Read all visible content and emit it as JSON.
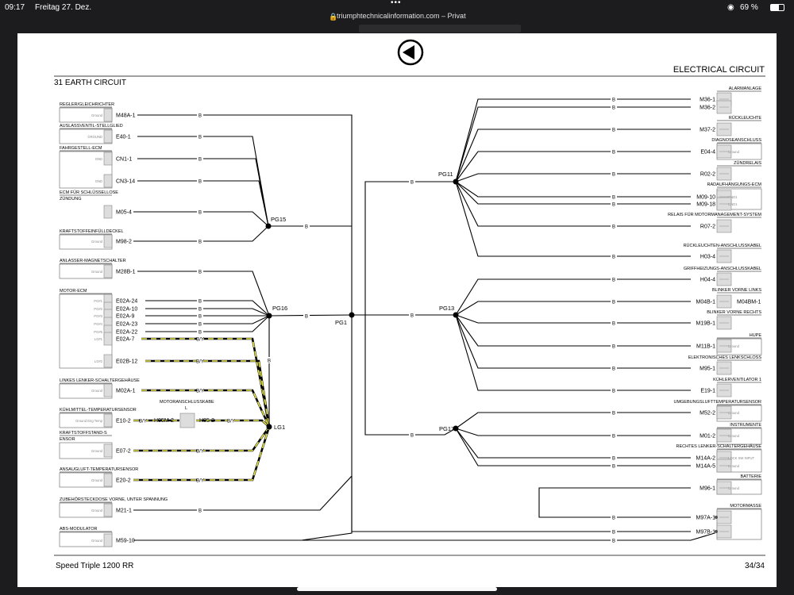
{
  "status": {
    "time": "09:17",
    "date": "Freitag 27. Dez.",
    "url": "triumphtechnicalinformation.com – Privat",
    "battery": "69 %",
    "dots": "•••"
  },
  "doc": {
    "header": "ELECTRICAL CIRCUIT",
    "section": "31 EARTH CIRCUIT",
    "footer_left": "Speed Triple 1200 RR",
    "footer_right": "34/34"
  },
  "wire": {
    "b": "B",
    "by": "B/Y"
  },
  "nodes": {
    "pg15": "PG15",
    "pg16": "PG16",
    "pg1": "PG1",
    "lg1": "LG1",
    "pg11": "PG11",
    "pg13": "PG13",
    "pg17": "PG17"
  },
  "left": [
    {
      "title": "REGLER/GLEICHRICHTER",
      "pins": [
        {
          "name": "M48A-1",
          "inner": "Ground"
        }
      ]
    },
    {
      "title": "AUSLASSVENTIL-STELLGLIED",
      "pins": [
        {
          "name": "E40-1",
          "inner": "GROUND"
        }
      ]
    },
    {
      "title": "FAHRGESTELL-ECM",
      "pins": [
        {
          "name": "CN1-1",
          "inner": "GND"
        },
        {
          "name": "CN3-14",
          "inner": "GND"
        }
      ]
    },
    {
      "title": "ECM FÜR SCHLÜSSELLOSE",
      "title2": "ZÜNDUNG",
      "pins": [
        {
          "name": "M05-4",
          "inner": ""
        }
      ]
    },
    {
      "title": "KRAFTSTOFFEINFÜLLDECKEL",
      "pins": [
        {
          "name": "M98-2",
          "inner": "Ground"
        }
      ]
    },
    {
      "title": "ANLASSER-MAGNETSCHALTER",
      "pins": [
        {
          "name": "M28B-1",
          "inner": "Ground"
        }
      ]
    },
    {
      "title": "MOTOR-ECM",
      "pins": [
        {
          "name": "E02A-24",
          "inner": "PG#1"
        },
        {
          "name": "E02A-10",
          "inner": "PG#2"
        },
        {
          "name": "E02A-9",
          "inner": "PG#3"
        },
        {
          "name": "E02A-23",
          "inner": "PG#4"
        },
        {
          "name": "E02A-22",
          "inner": "PG#5"
        },
        {
          "name": "E02A-7",
          "inner": "LG#1"
        },
        {
          "name": "E02B-12",
          "inner": "LG#2"
        }
      ]
    },
    {
      "title": "LINKES LENKER-SCHALTERGEHÄUSE",
      "pins": [
        {
          "name": "M02A-1",
          "inner": "Ground"
        }
      ]
    },
    {
      "title": "KÜHLMITTEL-TEMPERATURSENSOR",
      "pins": [
        {
          "name": "E10-2",
          "inner": "Ground Eng Temp"
        }
      ]
    },
    {
      "title": "KRAFTSTOFFSTAND-S",
      "title2": "ENSOR",
      "pins": [
        {
          "name": "E07-2",
          "inner": "Ground"
        }
      ]
    },
    {
      "title": "ANSAUGLUFT-TEMPERATURSENSOR",
      "pins": [
        {
          "name": "E20-2",
          "inner": "Ground"
        }
      ]
    },
    {
      "title": "ZUBEHÖRSTECKDOSE VORNE, UNTER SPANNUNG",
      "pins": [
        {
          "name": "M21-1",
          "inner": "Ground"
        }
      ]
    },
    {
      "title": "ABS-MODULATOR",
      "pins": [
        {
          "name": "M59-10",
          "inner": "Ground"
        }
      ]
    }
  ],
  "motorkabel": {
    "title": "MOTORANSCHLUSSKABE",
    "title2": "L",
    "pin_a": "H05M-2",
    "pin_b": "H05-2"
  },
  "right": [
    {
      "title": "ALARMANLAGE",
      "pins": [
        {
          "name": "M36-1",
          "inner": ""
        },
        {
          "name": "M36-2",
          "inner": ""
        }
      ]
    },
    {
      "title": "RÜCKLEUCHTE",
      "pins": [
        {
          "name": "M37-2",
          "inner": ""
        }
      ]
    },
    {
      "title": "DIAGNOSEANSCHLUSS",
      "pins": [
        {
          "name": "E04-4",
          "inner": "Ground"
        }
      ]
    },
    {
      "title": "ZÜNDRELAIS",
      "pins": [
        {
          "name": "R02-2",
          "inner": ""
        }
      ]
    },
    {
      "title": "RADAUFHÄNGUNGS-ECM",
      "pins": [
        {
          "name": "M09-10",
          "inner": "GND1"
        },
        {
          "name": "M09-18",
          "inner": "GND1"
        }
      ]
    },
    {
      "title": "RELAIS FÜR MOTORMANAGEMENT-SYSTEM",
      "pins": [
        {
          "name": "R07-2",
          "inner": ""
        }
      ]
    },
    {
      "title": "RÜCKLEUCHTEN-ANSCHLUSSKABEL",
      "pins": [
        {
          "name": "H03-4",
          "inner": ""
        }
      ]
    },
    {
      "title": "GRIFFHEIZUNGS-ANSCHLUSSKABEL",
      "pins": [
        {
          "name": "H04-4",
          "inner": ""
        }
      ]
    },
    {
      "title": "BLINKER VORNE LINKS",
      "pins": [
        {
          "name": "M04B-1",
          "inner": ""
        }
      ],
      "extra": "M04BM-1"
    },
    {
      "title": "BLINKER VORNE RECHTS",
      "pins": [
        {
          "name": "M19B-1",
          "inner": ""
        }
      ]
    },
    {
      "title": "HUPE",
      "pins": [
        {
          "name": "M11B-1",
          "inner": "Ground"
        }
      ]
    },
    {
      "title": "ELEKTRONISCHES LENKSCHLOSS",
      "pins": [
        {
          "name": "M95-1",
          "inner": ""
        }
      ]
    },
    {
      "title": "KÜHLERVENTILATOR 1",
      "pins": [
        {
          "name": "E19-1",
          "inner": ""
        }
      ]
    },
    {
      "title": "UMGEBUNGSLUFTTEMPERATURSENSOR",
      "pins": [
        {
          "name": "M52-2",
          "inner": "Ground"
        }
      ]
    },
    {
      "title": "INSTRUMENTE",
      "pins": [
        {
          "name": "M01-2",
          "inner": "Ground"
        }
      ]
    },
    {
      "title": "RECHTES LENKER-SCHALTERGEHÄUSE",
      "pins": [
        {
          "name": "M14A-2",
          "inner": "LOCK SW INPUT"
        },
        {
          "name": "M14A-5",
          "inner": "Ground"
        }
      ]
    },
    {
      "title": "BATTERIE",
      "pins": [
        {
          "name": "M96-1",
          "inner": "Ground"
        }
      ]
    },
    {
      "title": "MOTORMASSE",
      "pins": [
        {
          "name": "M97A-1",
          "inner": ""
        },
        {
          "name": "M97B-1",
          "inner": ""
        }
      ]
    }
  ]
}
